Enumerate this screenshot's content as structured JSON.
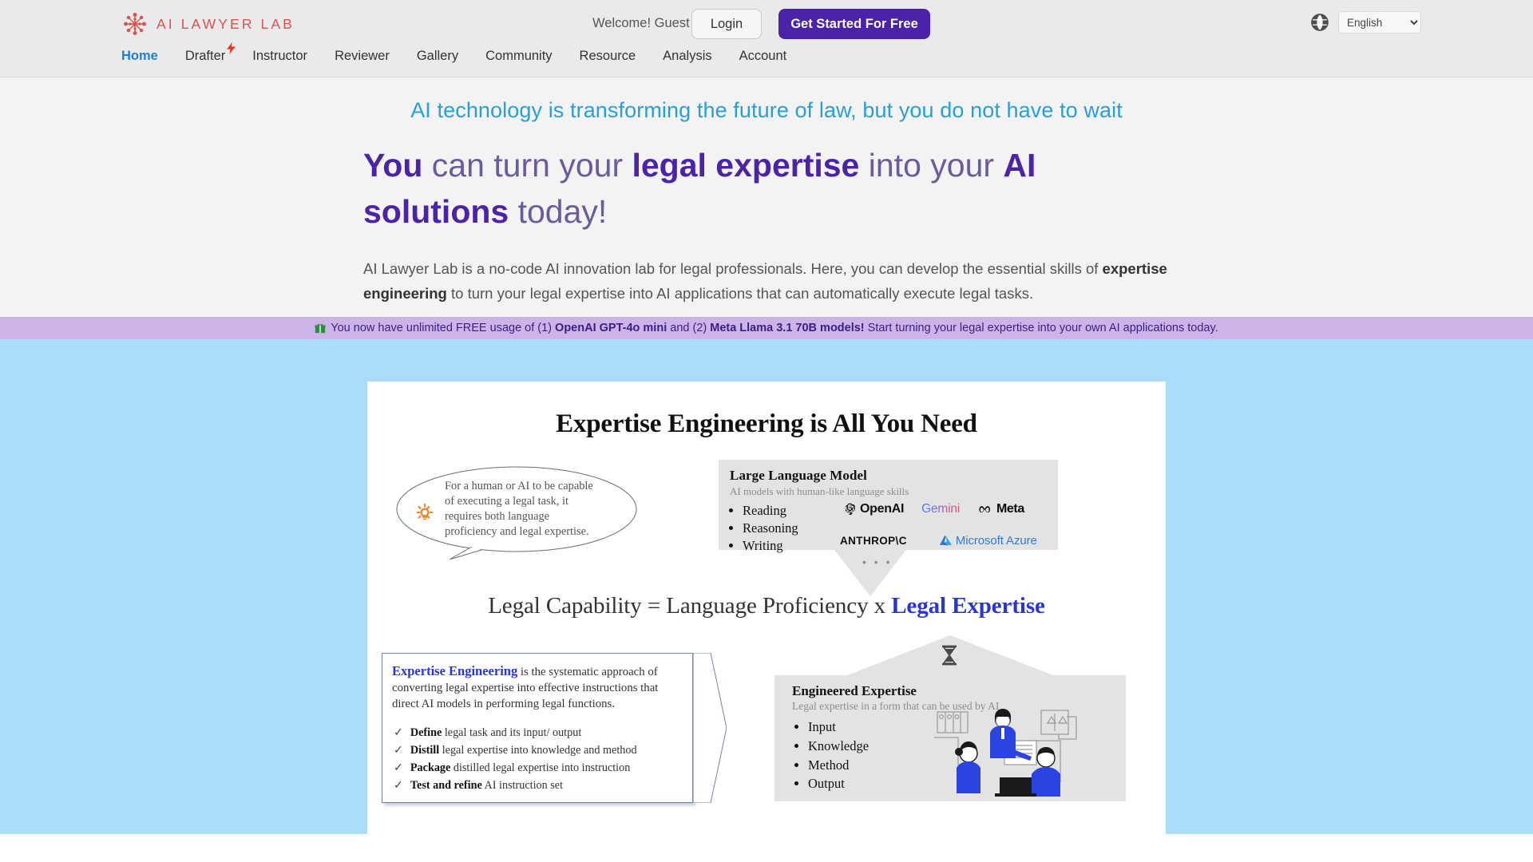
{
  "brand": {
    "name": "AI LAWYER LAB",
    "logo_icon": "molecule-logo-icon",
    "color": "#d9534f"
  },
  "header": {
    "welcome": "Welcome! Guest",
    "login_label": "Login",
    "cta_label": "Get Started For Free",
    "cta_color": "#4a23a9",
    "globe_icon": "globe-icon",
    "language": "English",
    "language_options": [
      "English"
    ]
  },
  "nav": {
    "items": [
      {
        "label": "Home",
        "active": true
      },
      {
        "label": "Drafter",
        "active": false,
        "badge_icon": "lightning-bolt-icon"
      },
      {
        "label": "Instructor",
        "active": false
      },
      {
        "label": "Reviewer",
        "active": false
      },
      {
        "label": "Gallery",
        "active": false
      },
      {
        "label": "Community",
        "active": false
      },
      {
        "label": "Resource",
        "active": false
      },
      {
        "label": "Analysis",
        "active": false
      },
      {
        "label": "Account",
        "active": false
      }
    ],
    "active_color": "#1f7fd1"
  },
  "hero": {
    "eyebrow": "AI technology is transforming the future of law, but you do not have to wait",
    "heading_parts": [
      {
        "text": "You",
        "bold": true
      },
      {
        "text": " can turn your ",
        "bold": false
      },
      {
        "text": "legal expertise",
        "bold": true
      },
      {
        "text": " into your ",
        "bold": false
      },
      {
        "text": "AI solutions",
        "bold": true
      },
      {
        "text": " today!",
        "bold": false
      }
    ],
    "heading_plain": "You can turn your legal expertise into your AI solutions today!",
    "paragraph_parts": [
      {
        "text": "AI Lawyer Lab is a no-code AI innovation lab for legal professionals. Here, you can develop the essential skills of ",
        "bold": false
      },
      {
        "text": "expertise engineering",
        "bold": true
      },
      {
        "text": " to turn your legal expertise into AI applications that can automatically execute legal tasks.",
        "bold": false
      }
    ],
    "heading_color": "#4a23a9",
    "eyebrow_color": "#2a9fd6"
  },
  "banner": {
    "icon": "gift-icon",
    "background": "#cdb4e8",
    "text_color": "#3a1d86",
    "parts": [
      {
        "text": "You now have unlimited FREE usage of  (1) ",
        "bold": false
      },
      {
        "text": "OpenAI GPT-4o mini",
        "bold": true
      },
      {
        "text": " and (2) ",
        "bold": false
      },
      {
        "text": "Meta Llama 3.1 70B models!",
        "bold": true
      },
      {
        "text": "  Start turning your legal expertise into your own AI applications today.",
        "bold": false
      }
    ],
    "full_text": "You now have unlimited FREE usage of  (1) OpenAI GPT-4o mini and (2) Meta Llama 3.1 70B models!  Start turning your legal expertise into your own AI applications today."
  },
  "diagram": {
    "background": "#aadcfb",
    "title": "Expertise Engineering is All You Need",
    "bubble": {
      "icon": "sun-idea-icon",
      "text": "For a human or AI to be capable of executing a legal task, it requires both language proficiency and legal expertise."
    },
    "llm": {
      "title": "Large Language  Model",
      "subtitle": "AI models with human-like language skills",
      "items": [
        "Reading",
        "Reasoning",
        "Writing"
      ],
      "logos": [
        {
          "name": "OpenAI",
          "icon": "openai-logo-icon"
        },
        {
          "name": "Gemini",
          "icon": "gemini-logo-icon"
        },
        {
          "name": "Meta",
          "icon": "meta-logo-icon"
        },
        {
          "name": "ANTHROP\\C",
          "icon": "anthropic-logo-icon"
        },
        {
          "name": "Microsoft Azure",
          "icon": "azure-logo-icon"
        }
      ],
      "dots": "• • •"
    },
    "equation": {
      "left": "Legal Capability = Language Proficiency x ",
      "highlight": "Legal Expertise",
      "highlight_color": "#2a35d6",
      "full": "Legal Capability = Language Proficiency x Legal Expertise"
    },
    "expertise_engineering": {
      "term": "Expertise Engineering",
      "definition": " is the systematic approach of converting legal expertise into effective instructions that direct AI models in performing legal functions.",
      "check_icon": "check-mark-icon",
      "steps": [
        {
          "bold": "Define",
          "rest": " legal task and its input/ output"
        },
        {
          "bold": "Distill",
          "rest": " legal expertise into knowledge and method"
        },
        {
          "bold": "Package",
          "rest": " distilled legal expertise into instruction"
        },
        {
          "bold": "Test and refine",
          "rest": " AI instruction set"
        }
      ]
    },
    "engineered_expertise": {
      "title": "Engineered Expertise",
      "subtitle": "Legal expertise in a form that can be used by AI",
      "items": [
        "Input",
        "Knowledge",
        "Method",
        "Output"
      ],
      "hourglass_icon": "hourglass-icon",
      "illustration_icon": "legal-team-illustration"
    }
  }
}
